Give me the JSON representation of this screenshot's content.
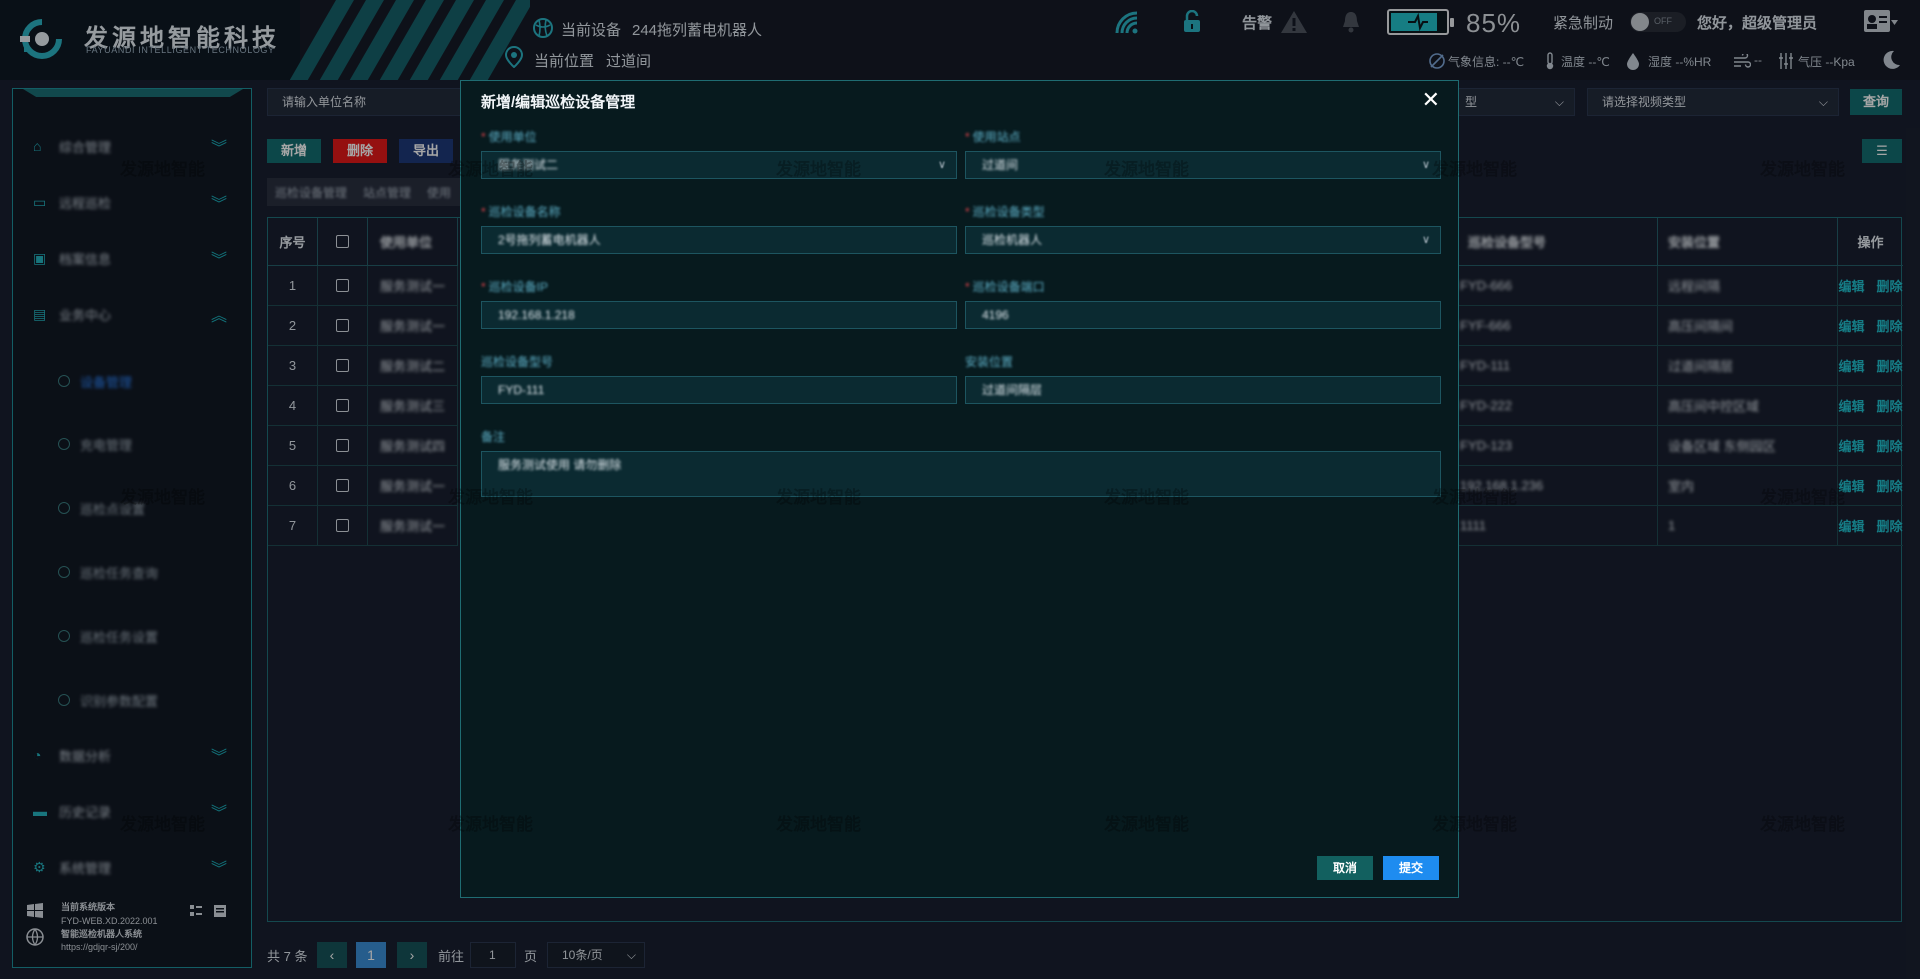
{
  "header": {
    "logo_cn": "发源地智能科技",
    "logo_en": "FAYUANDI INTELLIGENT TECHNOLOGY",
    "current_device_label": "当前设备",
    "current_device_value": "244拖列蓄电机器人",
    "current_location_label": "当前位置",
    "current_location_value": "过道间",
    "alarm_label": "告警",
    "battery_text": "85%",
    "battery_digits": "8",
    "battery_level": 0.85,
    "emergency_label": "紧急制动",
    "toggle_label": "OFF",
    "greeting": "您好，超级管理员",
    "weather_label": "气象信息: --℃",
    "temperature": "温度 --℃",
    "humidity": "湿度 --%HR",
    "wind": "--",
    "pressure": "气压 --Kpa"
  },
  "sidebar": {
    "menu": [
      {
        "label": "综合管理",
        "icon": "home-icon",
        "chev": "double-chevron-down"
      },
      {
        "label": "远程巡检",
        "icon": "monitor-icon",
        "chev": "double-chevron-down"
      },
      {
        "label": "档案信息",
        "icon": "image-icon",
        "chev": "double-chevron-down"
      },
      {
        "label": "业务中心",
        "icon": "briefcase-icon",
        "chev": "double-chevron-up"
      }
    ],
    "submenu": [
      {
        "label": "设备管理",
        "active": true
      },
      {
        "label": "充电管理"
      },
      {
        "label": "巡检点设置"
      },
      {
        "label": "巡检任务查询"
      },
      {
        "label": "巡检任务设置"
      },
      {
        "label": "识别参数配置"
      }
    ],
    "menu_bottom": [
      {
        "label": "数据分析"
      },
      {
        "label": "历史记录"
      },
      {
        "label": "系统管理"
      }
    ],
    "footer": {
      "version_label": "当前系统版本",
      "version": "FYD-WEB.XD.2022.001",
      "system_name": "智能巡检机器人系统",
      "url": "https://gdjqr-sj/200/"
    }
  },
  "toolbar": {
    "unit_placeholder": "请输入单位名称",
    "type_select": "型",
    "video_type_placeholder": "请选择视频类型",
    "query_label": "查询",
    "add_label": "新增",
    "delete_label": "删除",
    "export_label": "导出"
  },
  "tabs": [
    "巡检设备管理",
    "站点管理",
    "使用"
  ],
  "table": {
    "headers": {
      "index": "序号",
      "unit": "使用单位",
      "model": "巡检设备型号",
      "location": "安装位置",
      "ops": "操作"
    },
    "rows": [
      {
        "index": "1",
        "unit": "服务测试一",
        "model": "FYD-666",
        "location": "远程间隔"
      },
      {
        "index": "2",
        "unit": "服务测试一",
        "model": "FYF-666",
        "location": "高压间隔间"
      },
      {
        "index": "3",
        "unit": "服务测试二",
        "model": "FYD-111",
        "location": "过道间隔层"
      },
      {
        "index": "4",
        "unit": "服务测试三",
        "model": "FYD-222",
        "location": "高压间中控区域"
      },
      {
        "index": "5",
        "unit": "服务测试四",
        "model": "FYD-123",
        "location": "设备区域 东侧园区"
      },
      {
        "index": "6",
        "unit": "服务测试一",
        "model": "192.168.1.236",
        "location": "室内"
      },
      {
        "index": "7",
        "unit": "服务测试一",
        "model": "1111",
        "location": "1"
      }
    ],
    "edit_label": "编辑",
    "delete_label": "删除"
  },
  "pagination": {
    "total": "共 7 条",
    "current_page": "1",
    "goto_label": "前往",
    "goto_value": "1",
    "page_unit": "页",
    "page_size": "10条/页"
  },
  "dialog": {
    "title": "新增/编辑巡检设备管理",
    "fields": {
      "unit_label": "使用单位",
      "unit_value": "服务测试二",
      "site_label": "使用站点",
      "site_value": "过道间",
      "name_label": "巡检设备名称",
      "name_value": "2号拖列蓄电机器人",
      "type_label": "巡检设备类型",
      "type_value": "巡检机器人",
      "ip_label": "巡检设备IP",
      "ip_value": "192.168.1.218",
      "port_label": "巡检设备端口",
      "port_value": "4196",
      "model_label": "巡检设备型号",
      "model_value": "FYD-111",
      "location_label": "安装位置",
      "location_value": "过道间隔层",
      "remark_label": "备注",
      "remark_value": "服务测试使用 请勿删除"
    },
    "cancel_label": "取消",
    "submit_label": "提交"
  },
  "watermark": "发源地智能",
  "colors": {
    "accent": "#1cb7c3",
    "submit": "#1e8cf0",
    "danger": "#e51a1a"
  }
}
